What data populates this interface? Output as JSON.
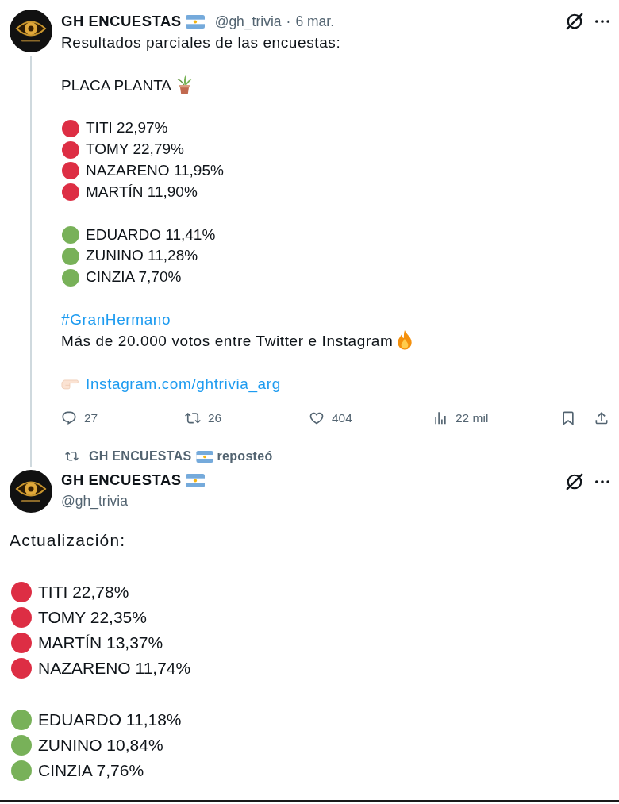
{
  "thread_post": {
    "author": "GH ENCUESTAS",
    "handle": "@gh_trivia",
    "separator": "·",
    "date": "6 mar.",
    "paragraphs": [
      [
        {
          "kind": "text",
          "text": "Resultados parciales de las encuestas:"
        }
      ],
      [
        {
          "kind": "heading",
          "text": "PLACA PLANTA"
        }
      ],
      [
        {
          "kind": "candidate",
          "color": "#dd2e44",
          "text": "TITI 22,97%"
        },
        {
          "kind": "candidate",
          "color": "#dd2e44",
          "text": "TOMY 22,79%"
        },
        {
          "kind": "candidate",
          "color": "#dd2e44",
          "text": "NAZARENO 11,95%"
        },
        {
          "kind": "candidate",
          "color": "#dd2e44",
          "text": "MARTÍN 11,90%"
        }
      ],
      [
        {
          "kind": "candidate",
          "color": "#78b159",
          "text": "EDUARDO 11,41%"
        },
        {
          "kind": "candidate",
          "color": "#78b159",
          "text": "ZUNINO 11,28%"
        },
        {
          "kind": "candidate",
          "color": "#78b159",
          "text": "CINZIA 7,70%"
        }
      ],
      [
        {
          "kind": "hashtag",
          "text": "#GranHermano"
        },
        {
          "kind": "note",
          "text": "Más de 20.000 votos entre Twitter e Instagram"
        }
      ],
      [
        {
          "kind": "link",
          "text": "Instagram.com/ghtrivia_arg"
        }
      ]
    ],
    "actions": [
      {
        "kind": "reply",
        "count": "27"
      },
      {
        "kind": "repost",
        "count": "26"
      },
      {
        "kind": "like",
        "count": "404"
      },
      {
        "kind": "views",
        "count": "22 mil"
      },
      {
        "kind": "bookmark"
      },
      {
        "kind": "share"
      }
    ]
  },
  "repost_banner": {
    "user": "GH ENCUESTAS",
    "label": "reposteó"
  },
  "post": {
    "author": "GH ENCUESTAS",
    "handle": "@gh_trivia",
    "paragraphs": [
      [
        {
          "kind": "text",
          "text": "Actualización:"
        }
      ],
      [
        {
          "kind": "candidate",
          "color": "#dd2e44",
          "text": "TITI 22,78%"
        },
        {
          "kind": "candidate",
          "color": "#dd2e44",
          "text": "TOMY 22,35%"
        },
        {
          "kind": "candidate",
          "color": "#dd2e44",
          "text": "MARTÍN 13,37%"
        },
        {
          "kind": "candidate",
          "color": "#dd2e44",
          "text": "NAZARENO 11,74%"
        }
      ],
      [
        {
          "kind": "candidate",
          "color": "#78b159",
          "text": "EDUARDO 11,18%"
        },
        {
          "kind": "candidate",
          "color": "#78b159",
          "text": "ZUNINO 10,84%"
        },
        {
          "kind": "candidate",
          "color": "#78b159",
          "text": "CINZIA 7,76%"
        }
      ]
    ]
  }
}
